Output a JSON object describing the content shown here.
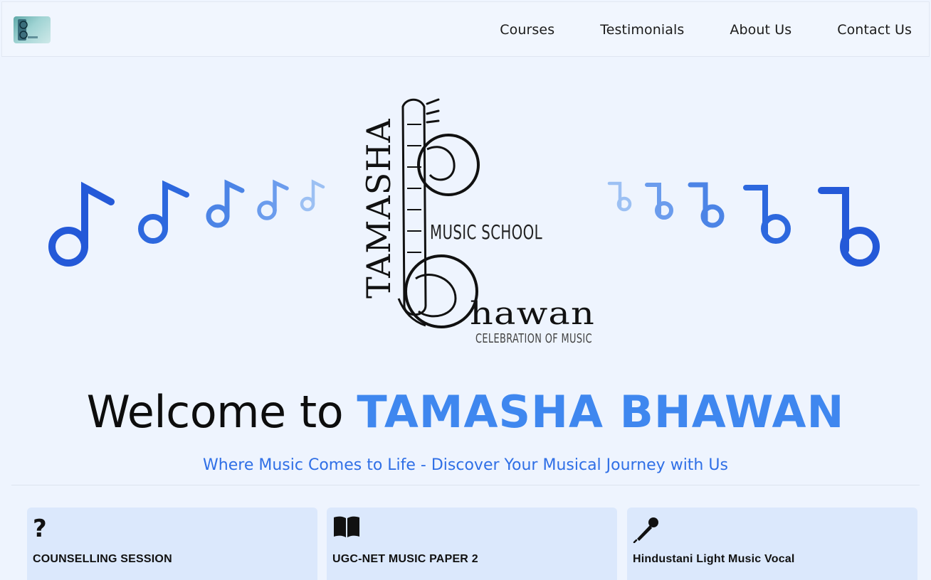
{
  "nav": {
    "logo_alt": "Tamasha Bhawan",
    "links": [
      {
        "label": "Courses"
      },
      {
        "label": "Testimonials"
      },
      {
        "label": "About Us"
      },
      {
        "label": "Contact Us"
      }
    ]
  },
  "hero": {
    "logo": {
      "vertical_text": "TAMASHA",
      "line1": "MUSIC SCHOOL",
      "line2": "hawan",
      "line3": "CELEBRATION OF MUSIC"
    },
    "headline_prefix": "Welcome to ",
    "headline_brand": "TAMASHA BHAWAN",
    "tagline": "Where Music Comes to Life - Discover Your Musical Journey with Us"
  },
  "colors": {
    "brand_blue": "#3f87ef",
    "tagline_blue": "#2f6fe6",
    "note_dark": "#2c63d8",
    "background": "#eef4fe",
    "card_bg": "#dbe8fc"
  },
  "cards": [
    {
      "icon": "question-icon",
      "title": "COUNSELLING SESSION"
    },
    {
      "icon": "book-icon",
      "title": "UGC-NET MUSIC PAPER 2"
    },
    {
      "icon": "microphone-icon",
      "title": "Hindustani Light Music Vocal"
    }
  ]
}
